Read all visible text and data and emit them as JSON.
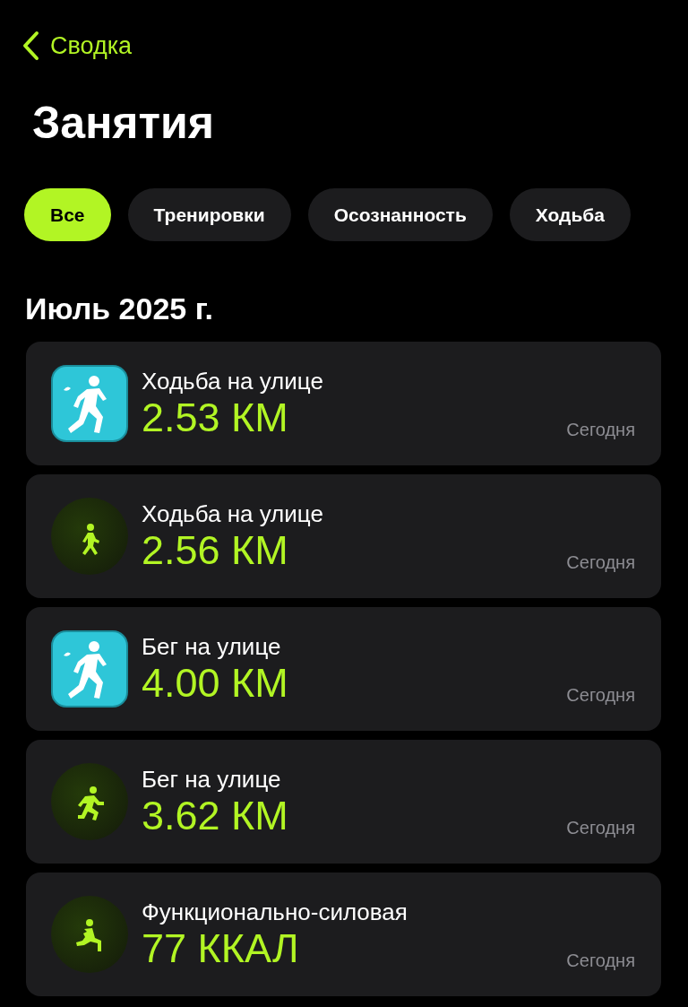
{
  "nav": {
    "back_label": "Сводка"
  },
  "title": "Занятия",
  "filters": [
    {
      "label": "Все",
      "selected": true
    },
    {
      "label": "Тренировки",
      "selected": false
    },
    {
      "label": "Осознанность",
      "selected": false
    },
    {
      "label": "Ходьба",
      "selected": false
    }
  ],
  "section": "Июль 2025 г.",
  "activities": [
    {
      "kind": "app",
      "name": "Ходьба на улице",
      "value": "2.53 КМ",
      "date": "Сегодня"
    },
    {
      "kind": "walk",
      "name": "Ходьба на улице",
      "value": "2.56 КМ",
      "date": "Сегодня"
    },
    {
      "kind": "app",
      "name": "Бег на улице",
      "value": "4.00 КМ",
      "date": "Сегодня"
    },
    {
      "kind": "run",
      "name": "Бег на улице",
      "value": "3.62 КМ",
      "date": "Сегодня"
    },
    {
      "kind": "strength",
      "name": "Функционально-силовая",
      "value": "77 ККАЛ",
      "date": "Сегодня"
    }
  ]
}
